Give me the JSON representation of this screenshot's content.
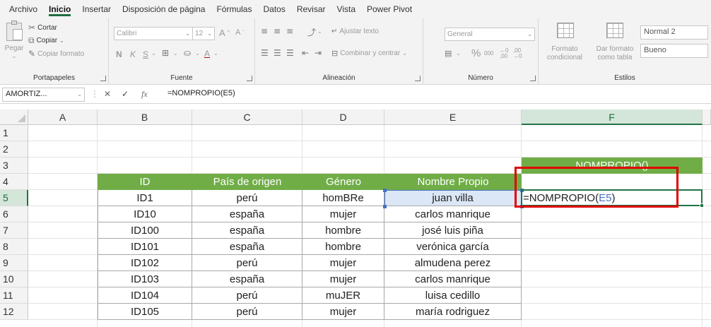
{
  "menu": [
    "Archivo",
    "Inicio",
    "Insertar",
    "Disposición de página",
    "Fórmulas",
    "Datos",
    "Revisar",
    "Vista",
    "Power Pivot"
  ],
  "active_tab": "Inicio",
  "ribbon": {
    "clipboard": {
      "paste": "Pegar",
      "cut": "Cortar",
      "copy": "Copiar",
      "format_painter": "Copiar formato",
      "label": "Portapapeles"
    },
    "font": {
      "name": "Calibri",
      "size": "12",
      "bold": "N",
      "italic": "K",
      "underline": "S",
      "label": "Fuente"
    },
    "alignment": {
      "wrap": "Ajustar texto",
      "merge": "Combinar y centrar",
      "label": "Alineación"
    },
    "number": {
      "format": "General",
      "percent": "%",
      "thousands": "000",
      "label": "Número"
    },
    "styles": {
      "conditional": "Formato condicional",
      "as_table": "Dar formato como tabla",
      "normal": "Normal 2",
      "good": "Bueno",
      "label": "Estilos"
    }
  },
  "formula_bar": {
    "name_box": "AMORTIZ...",
    "fx": "fx",
    "formula": "=NOMPROPIO(E5)"
  },
  "columns": [
    "A",
    "B",
    "C",
    "D",
    "E",
    "F"
  ],
  "selected_column": "F",
  "rows": [
    "1",
    "2",
    "3",
    "4",
    "5",
    "6",
    "7",
    "8",
    "9",
    "10",
    "11",
    "12"
  ],
  "selected_row": "5",
  "sheet": {
    "f3_header": "NOMPROPIO()",
    "table_headers": [
      "ID",
      "País de origen",
      "Género",
      "Nombre Propio"
    ],
    "table_rows": [
      [
        "ID1",
        "perú",
        "homBRe",
        "juan villa"
      ],
      [
        "ID10",
        "españa",
        "mujer",
        "carlos manrique"
      ],
      [
        "ID100",
        "españa",
        "hombre",
        "josé luis piña"
      ],
      [
        "ID101",
        "españa",
        "hombre",
        "verónica garcía"
      ],
      [
        "ID102",
        "perú",
        "mujer",
        "almudena perez"
      ],
      [
        "ID103",
        "españa",
        "mujer",
        "carlos manrique"
      ],
      [
        "ID104",
        "perú",
        "muJER",
        "luisa cedillo"
      ],
      [
        "ID105",
        "perú",
        "mujer",
        "maría rodriguez"
      ]
    ],
    "f5_formula_prefix": "=NOMPROPIO(",
    "f5_formula_ref": "E5",
    "f5_formula_suffix": ")"
  },
  "colors": {
    "header_green": "#70ad47",
    "excel_green": "#217346",
    "highlight_red": "#e00000",
    "ref_blue": "#4472c4",
    "ref_fill": "#dbe7f6"
  }
}
